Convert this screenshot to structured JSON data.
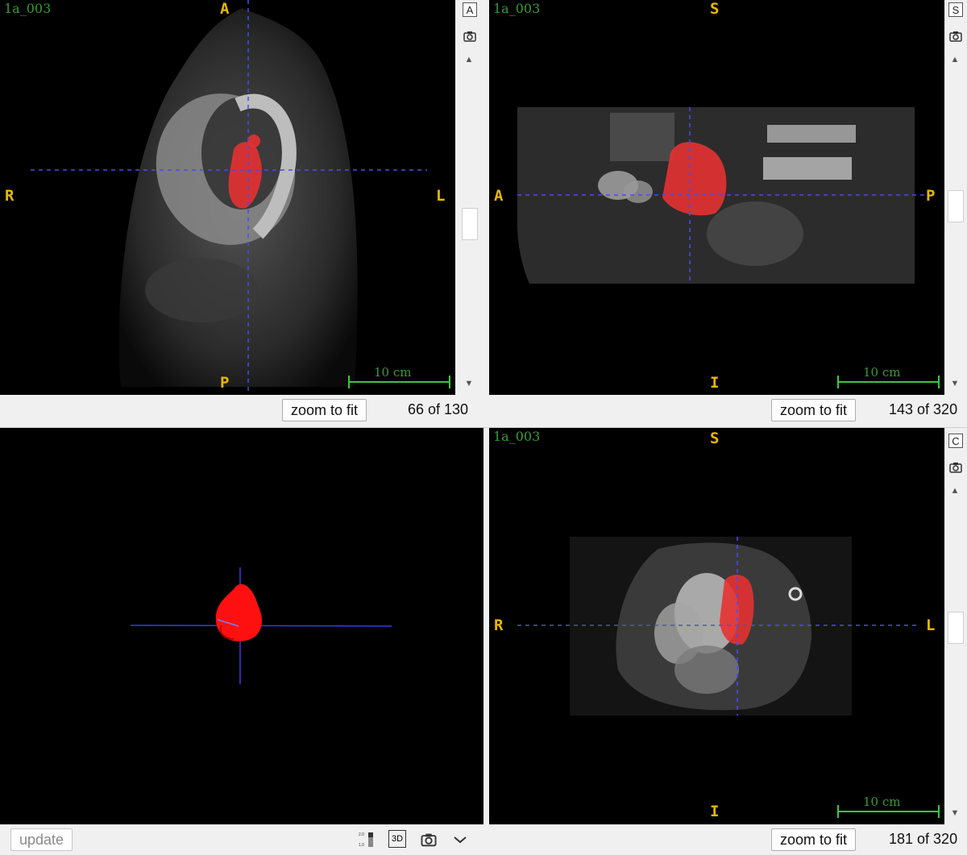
{
  "image_name": "1a_003",
  "views": {
    "axial": {
      "labels": {
        "top": "A",
        "bottom": "P",
        "left": "R",
        "right": "L"
      },
      "scale_label": "10 cm",
      "view_button": "A",
      "zoom_label": "zoom to fit",
      "slice_text": "66 of 130"
    },
    "sagittal": {
      "labels": {
        "top": "S",
        "bottom": "I",
        "left": "A",
        "right": "P"
      },
      "scale_label": "10 cm",
      "view_button": "S",
      "zoom_label": "zoom to fit",
      "slice_text": "143 of 320"
    },
    "coronal": {
      "labels": {
        "top": "S",
        "bottom": "I",
        "left": "R",
        "right": "L"
      },
      "scale_label": "10 cm",
      "view_button": "C",
      "zoom_label": "zoom to fit",
      "slice_text": "181 of 320"
    },
    "render3d": {
      "update_label": "update"
    }
  },
  "toolbar": {
    "icons": [
      "colorbar-icon",
      "3d-icon",
      "camera-icon",
      "chevron-down-icon"
    ],
    "label_3d": "3D",
    "colorbar_ticks": [
      "2.0",
      "1.0"
    ]
  },
  "colors": {
    "orientation_label": "#e8b800",
    "image_name": "#3a9a3a",
    "crosshair": "#4a4af0",
    "segmentation": "#e63232"
  }
}
